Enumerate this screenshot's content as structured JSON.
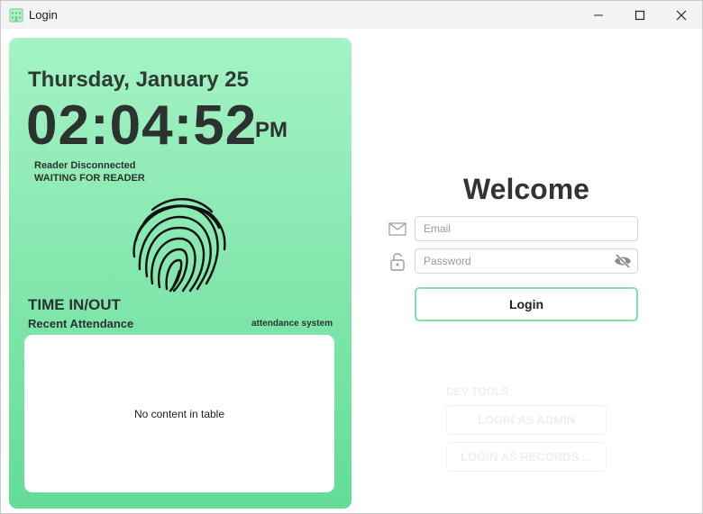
{
  "window": {
    "title": "Login",
    "icons": {
      "app": "building-icon",
      "minimize": "minimize-icon",
      "maximize": "maximize-icon",
      "close": "close-icon"
    }
  },
  "clock_panel": {
    "date": "Thursday, January 25",
    "time": "02:04:52",
    "ampm": "PM",
    "reader_status": "Reader Disconnected",
    "reader_state": "WAITING FOR READER",
    "icon": "fingerprint-icon",
    "section_title": "TIME IN/OUT",
    "recent_label": "Recent Attendance",
    "system_label": "attendance system",
    "table_empty_text": "No content in table",
    "colors": {
      "gradient_top": "#a4f4c3",
      "gradient_bottom": "#63dc98"
    }
  },
  "login": {
    "heading": "Welcome",
    "email_placeholder": "Email",
    "password_placeholder": "Password",
    "email_icon": "envelope-icon",
    "password_icon": "lock-icon",
    "toggle_icon": "eye-slash-icon",
    "button_label": "Login",
    "accent": "#7fe0a8"
  },
  "dev_tools": {
    "title": "DEV TOOLS",
    "admin_label": "LOGIN AS ADMIN",
    "records_label": "LOGIN AS RECORDS ..."
  }
}
